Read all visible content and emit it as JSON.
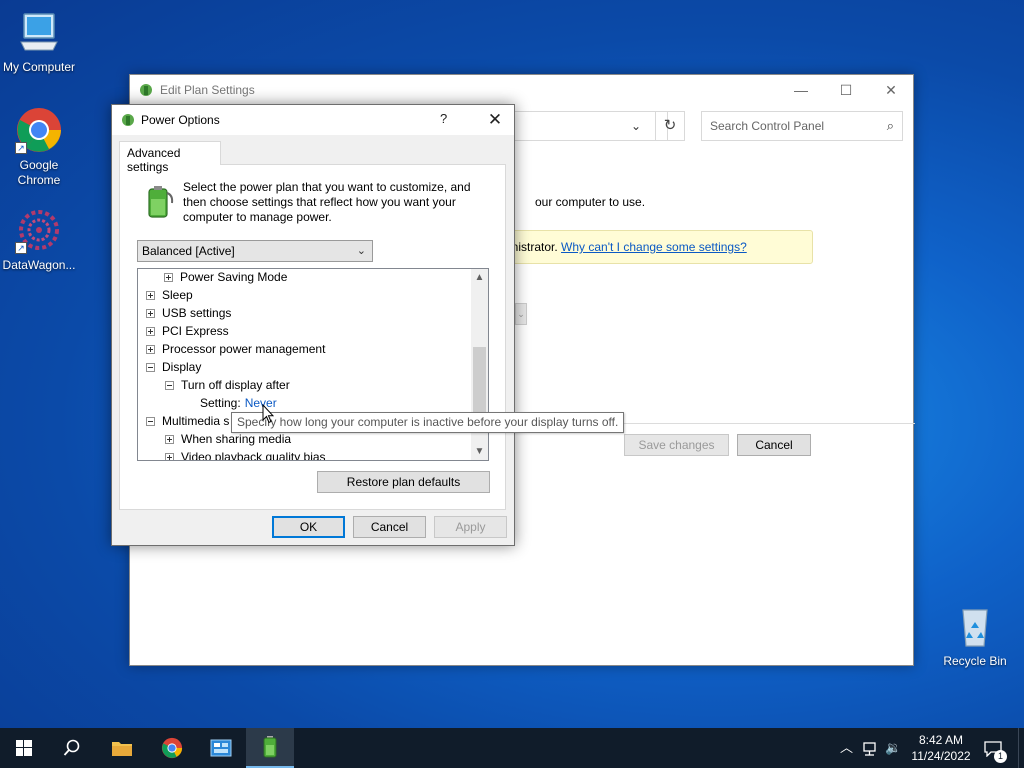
{
  "desktop": {
    "icons": [
      {
        "label": "My Computer",
        "icon": "monitor-icon"
      },
      {
        "label": "Google Chrome",
        "icon": "chrome-icon"
      },
      {
        "label": "DataWagon...",
        "icon": "datawagon-icon"
      },
      {
        "label": "Recycle Bin",
        "icon": "recycle-bin-icon"
      }
    ]
  },
  "edit_plan": {
    "title": "Edit Plan Settings",
    "search_placeholder": "Search Control Panel",
    "description_fragment": "our computer to use.",
    "info_prefix": "inistrator.",
    "info_link": "Why can't I change some settings?",
    "save_label": "Save changes",
    "cancel_label": "Cancel",
    "window_controls": {
      "minimize": "—",
      "maximize": "☐",
      "close": "✕"
    }
  },
  "power_options": {
    "title": "Power Options",
    "help": "?",
    "close": "✕",
    "tab": "Advanced settings",
    "intro": "Select the power plan that you want to customize, and then choose settings that reflect how you want your computer to manage power.",
    "plan_select": "Balanced [Active]",
    "tree": {
      "power_saving": "Power Saving Mode",
      "sleep": "Sleep",
      "usb": "USB settings",
      "pci": "PCI Express",
      "processor": "Processor power management",
      "display": "Display",
      "turn_off_display": "Turn off display after",
      "setting_label": "Setting:",
      "setting_value": "Never",
      "multimedia": "Multimedia s",
      "sharing_media": "When sharing media",
      "video_playback": "Video playback quality bias"
    },
    "restore_label": "Restore plan defaults",
    "ok_label": "OK",
    "cancel_label": "Cancel",
    "apply_label": "Apply"
  },
  "tooltip": "Specify how long your computer is inactive before your display turns off.",
  "taskbar": {
    "time": "8:42 AM",
    "date": "11/24/2022",
    "notification_count": "1"
  },
  "colors": {
    "accent": "#0078d7",
    "link": "#0b59c4",
    "taskbar": "#101c2a"
  }
}
